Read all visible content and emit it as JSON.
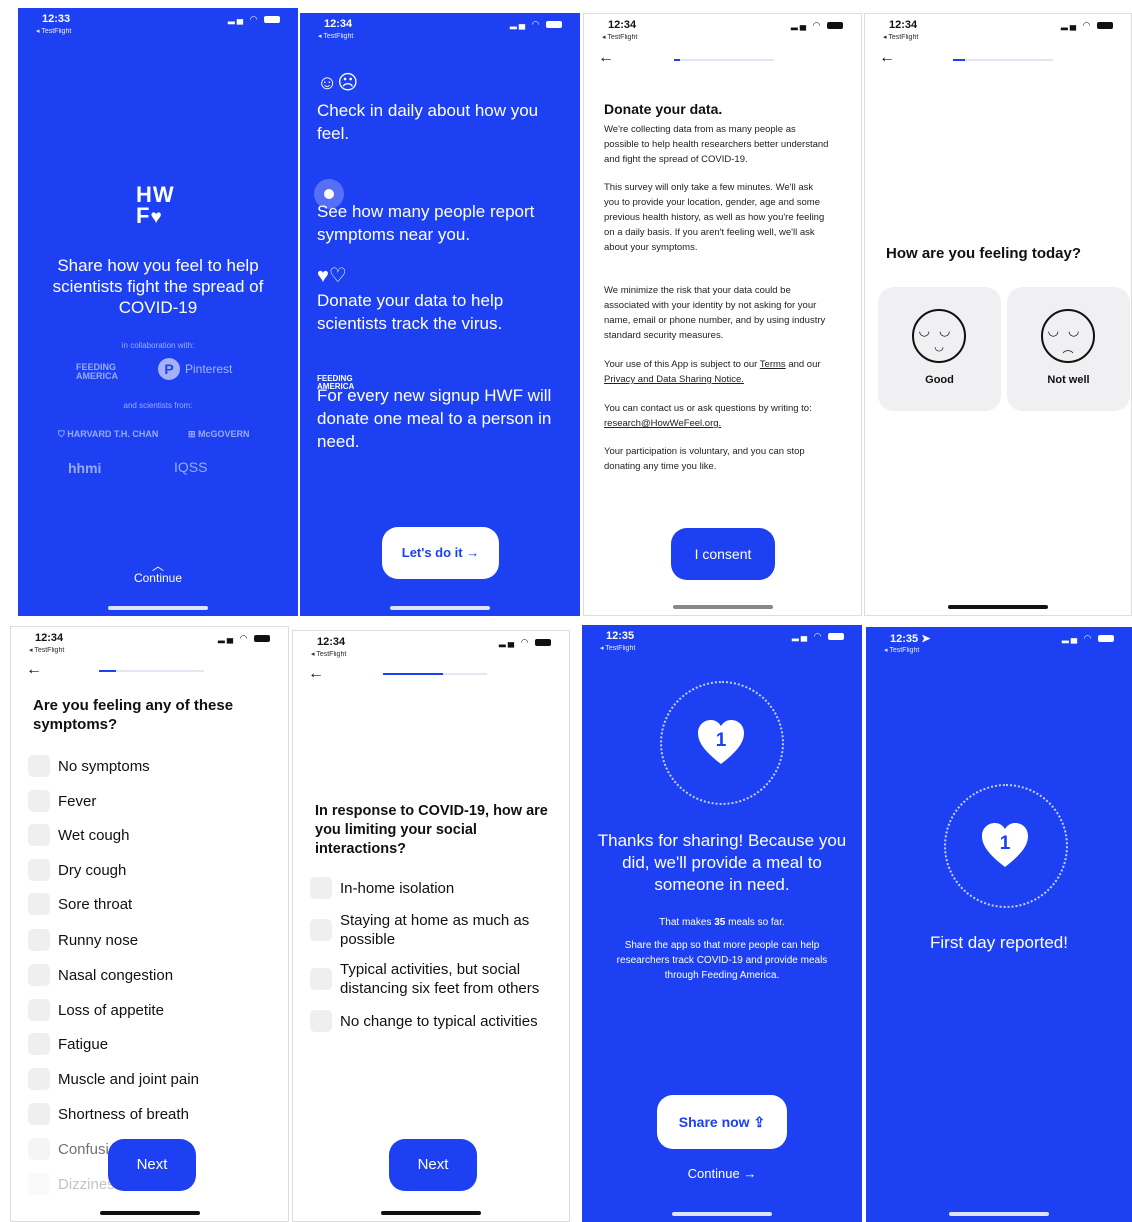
{
  "colors": {
    "brand_blue": "#1c40f2",
    "checkbox_bg": "#efefef",
    "card_bg": "#f0f0f2"
  },
  "screens": {
    "s1": {
      "time": "12:33",
      "testflight": "◂ TestFlight",
      "logo": "HW F",
      "title": "Share how you feel to help scientists fight the spread of COVID-19",
      "collab": "in collaboration with:",
      "partner_feeding": "FEEDING AMERICA",
      "partner_pinterest": "Pinterest",
      "scientists": "and scientists from:",
      "partner_harvard": "HARVARD T.H. CHAN",
      "partner_mcgovern": "McGOVERN",
      "partner_hhmi": "hhmi",
      "partner_iqss": "IQSS",
      "continue": "Continue"
    },
    "s2": {
      "time": "12:34",
      "testflight": "◂ TestFlight",
      "item1": "Check in daily about how you feel.",
      "item2": "See how many people report symptoms near you.",
      "item3": "Donate your data to help scientists track the virus.",
      "item4_logo": "FEEDING AMERICA",
      "item4": "For every new signup HWF will donate one meal to a person in need.",
      "button": "Let's do it →"
    },
    "s3": {
      "time": "12:34",
      "testflight": "◂ TestFlight",
      "title": "Donate your data.",
      "p1": "We're collecting data from as many people as possible to help health researchers better understand and fight the spread of COVID-19.",
      "p2": "This survey will only take a few minutes. We'll ask you to provide your location, gender, age and some previous health history, as well as how you're feeling on a daily basis. If you aren't feeling well, we'll ask about your symptoms.",
      "p3": "We minimize the risk that your data could be associated with your identity by not asking for your name, email or phone number, and by using industry standard security measures.",
      "p4_prefix": "Your use of this App is subject to our",
      "p4_terms": "Terms",
      "p4_mid": "and our",
      "p4_privacy": "Privacy and Data Sharing Notice.",
      "p5_prefix": "You can contact us or ask questions by writing to:",
      "p5_email": "research@HowWeFeel.org.",
      "p6": "Your participation is voluntary, and you can stop donating any time you like.",
      "button": "I consent"
    },
    "s4": {
      "time": "12:34",
      "testflight": "◂ TestFlight",
      "question": "How are you feeling today?",
      "good": "Good",
      "not_well": "Not well"
    },
    "s5": {
      "time": "12:34",
      "testflight": "◂ TestFlight",
      "question": "Are you feeling any of these symptoms?",
      "options": [
        "No symptoms",
        "Fever",
        "Wet cough",
        "Dry cough",
        "Sore throat",
        "Runny nose",
        "Nasal congestion",
        "Loss of appetite",
        "Fatigue",
        "Muscle and joint pain",
        "Shortness of breath",
        "Confusion",
        "Dizziness"
      ],
      "button": "Next"
    },
    "s6": {
      "time": "12:34",
      "testflight": "◂ TestFlight",
      "question": "In response to COVID-19, how are you limiting your social interactions?",
      "options": [
        "In-home isolation",
        "Staying at home as much as possible",
        "Typical activities, but social distancing six feet from others",
        "No change to typical activities"
      ],
      "button": "Next"
    },
    "s7": {
      "time": "12:35",
      "testflight": "◂ TestFlight",
      "heart_number": "1",
      "thanks": "Thanks for sharing! Because you did, we'll provide a meal to someone in need.",
      "meals_prefix": "That makes",
      "meals_count": "35",
      "meals_suffix": "meals so far.",
      "share_text": "Share the app so that more people can help researchers track COVID-19 and provide meals through Feeding America.",
      "share_button": "Share now",
      "continue": "Continue →"
    },
    "s8": {
      "time": "12:35 ➤",
      "testflight": "◂ TestFlight",
      "heart_number": "1",
      "message": "First day reported!"
    }
  }
}
